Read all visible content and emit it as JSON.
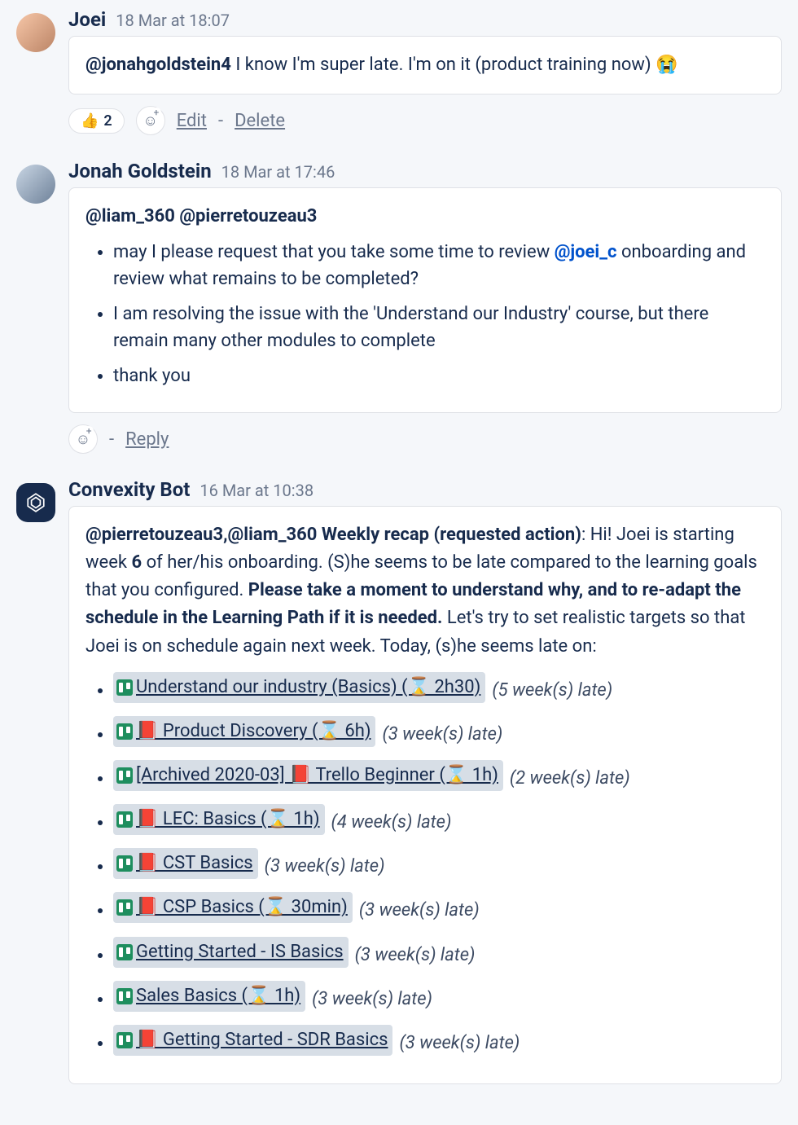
{
  "posts": {
    "joei": {
      "author": "Joei",
      "time": "18 Mar at 18:07",
      "mention": "@jonahgoldstein4",
      "body_rest": " I know I'm super late. I'm on it (product training now) ",
      "emoji": "😭",
      "reaction_emoji": "👍",
      "reaction_count": "2",
      "edit": "Edit",
      "delete": "Delete"
    },
    "jonah": {
      "author": "Jonah Goldstein",
      "time": "18 Mar at 17:46",
      "mentions_line": "@liam_360 @pierretouzeau3",
      "bullet1_a": "may I please request that you take some time to review ",
      "bullet1_mention": "@joei_c",
      "bullet1_b": " onboarding and review what remains to be completed?",
      "bullet2": "I am resolving the issue with the 'Understand our Industry' course, but there remain many other modules to complete",
      "bullet3": "thank you",
      "reply": "Reply"
    },
    "bot": {
      "author": "Convexity Bot",
      "time": "16 Mar at 10:38",
      "mentions": "@pierretouzeau3,@liam_360",
      "title_bold": " Weekly recap (requested action)",
      "p1": ": Hi! Joei is starting week ",
      "week_num": "6",
      "p2": " of her/his onboarding. (S)he seems to be late compared to the learning goals that you configured. ",
      "bold_mid": "Please take a moment to understand why, and to re-adapt the schedule in the Learning Path if it is needed.",
      "p3": " Let's try to set realistic targets so that Joei is on schedule again next week. Today, (s)he seems late on:",
      "cards": [
        {
          "book": false,
          "title": "Understand our industry (Basics) (⌛ 2h30)",
          "late": "(5 week(s) late)"
        },
        {
          "book": true,
          "title": " Product Discovery (⌛ 6h)",
          "late": "(3 week(s) late)"
        },
        {
          "book": true,
          "prefix": "[Archived 2020-03] ",
          "title": " Trello Beginner (⌛ 1h)",
          "late": "(2 week(s) late)"
        },
        {
          "book": true,
          "title": " LEC: Basics (⌛ 1h)",
          "late": "(4 week(s) late)"
        },
        {
          "book": true,
          "title": " CST Basics",
          "late": "(3 week(s) late)"
        },
        {
          "book": true,
          "title": " CSP Basics (⌛ 30min)",
          "late": "(3 week(s) late)"
        },
        {
          "book": false,
          "title": "Getting Started - IS Basics",
          "late": "(3 week(s) late)"
        },
        {
          "book": false,
          "title": "Sales Basics (⌛ 1h)",
          "late": "(3 week(s) late)"
        },
        {
          "book": true,
          "title": " Getting Started - SDR Basics",
          "late": "(3 week(s) late)"
        }
      ]
    }
  }
}
